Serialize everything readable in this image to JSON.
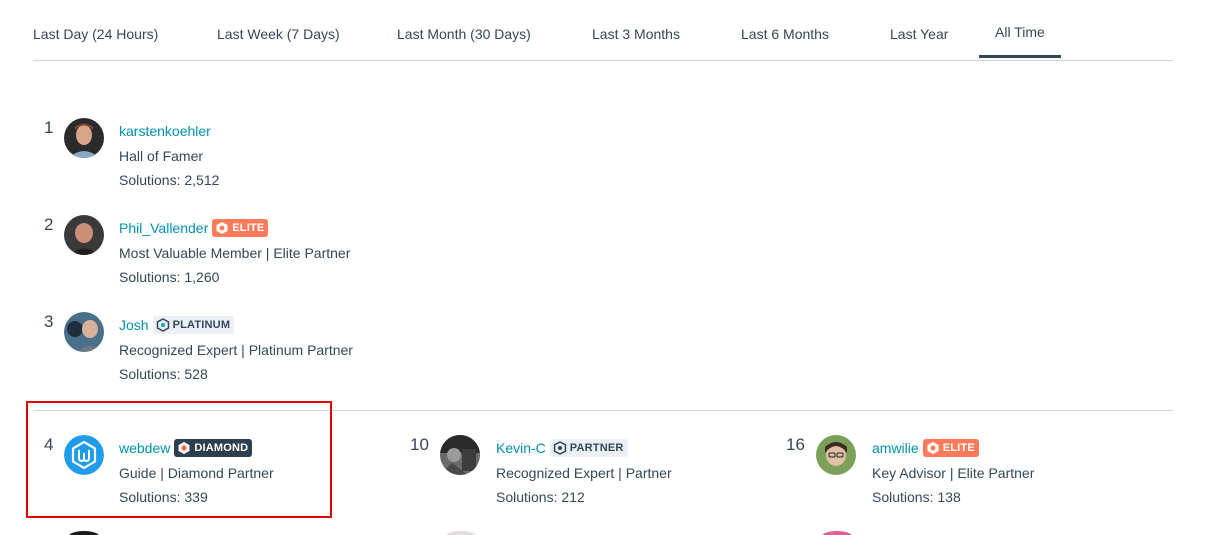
{
  "tabs": [
    {
      "label": "Last Day (24 Hours)"
    },
    {
      "label": "Last Week (7 Days)"
    },
    {
      "label": "Last Month (30 Days)"
    },
    {
      "label": "Last 3 Months"
    },
    {
      "label": "Last 6 Months"
    },
    {
      "label": "Last Year"
    },
    {
      "label": "All Time",
      "active": true
    }
  ],
  "leaders": [
    {
      "rank": "1",
      "username": "karstenkoehler",
      "role": "Hall of Famer",
      "solutions": "Solutions: 2,512"
    },
    {
      "rank": "2",
      "username": "Phil_Vallender",
      "badge": "ELITE",
      "role": "Most Valuable Member | Elite Partner",
      "solutions": "Solutions: 1,260"
    },
    {
      "rank": "3",
      "username": "Josh",
      "badge": "PLATINUM",
      "role": "Recognized Expert | Platinum Partner",
      "solutions": "Solutions: 528"
    },
    {
      "rank": "4",
      "username": "webdew",
      "badge": "DIAMOND",
      "role": "Guide | Diamond Partner",
      "solutions": "Solutions: 339"
    },
    {
      "rank": "10",
      "username": "Kevin-C",
      "badge": "PARTNER",
      "role": "Recognized Expert | Partner",
      "solutions": "Solutions: 212"
    },
    {
      "rank": "16",
      "username": "amwilie",
      "badge": "ELITE",
      "role": "Key Advisor | Elite Partner",
      "solutions": "Solutions: 138"
    }
  ],
  "colors": {
    "link": "#0091ae",
    "text": "#33475b",
    "elite": "#ff7a59",
    "diamond": "#2d3e50",
    "light_badge": "#eaf0f6",
    "highlight": "#e00000"
  },
  "icons": [
    "hexagon-badge-icon",
    "webdew-logo-icon"
  ]
}
